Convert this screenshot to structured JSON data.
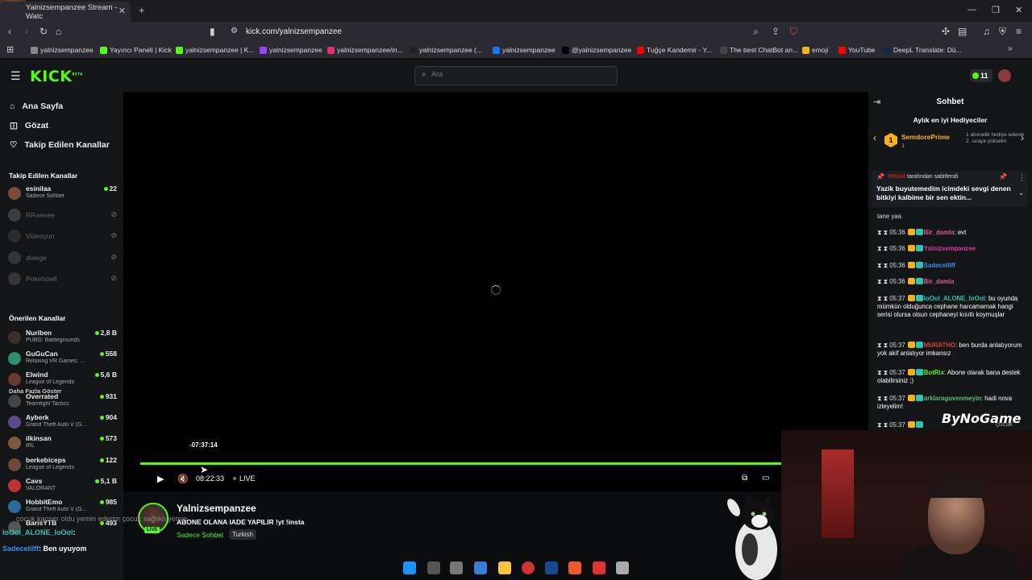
{
  "browser": {
    "tab_title": "Yalnizsempanzee Stream - Watc",
    "tab_close": "✕",
    "new_tab": "+",
    "url": "kick.com/yalnizsempanzee",
    "overlay_number": "12",
    "bookmarks": [
      {
        "label": "yalnizsempanzee",
        "color": "#888888"
      },
      {
        "label": "Yayıncı Paneli | Kick",
        "color": "#53fc18"
      },
      {
        "label": "yalnizsempanzee | K...",
        "color": "#53fc18"
      },
      {
        "label": "yalnizsempanzee",
        "color": "#9146ff"
      },
      {
        "label": "yalnizsempanzee/in...",
        "color": "#e1306c"
      },
      {
        "label": "yalnizsempanzee (...",
        "color": "#222222"
      },
      {
        "label": "yalnizsempanzee",
        "color": "#1877f2"
      },
      {
        "label": "@yalnizsempanzee",
        "color": "#000000"
      },
      {
        "label": "Tuğçe Kandemir - Y...",
        "color": "#ff0000"
      },
      {
        "label": "The best ChatBot an...",
        "color": "#444444"
      },
      {
        "label": "emoji",
        "color": "#f5b31b"
      },
      {
        "label": "YouTube",
        "color": "#ff0000"
      },
      {
        "label": "DeepL Translate: Dü...",
        "color": "#0f2b46"
      }
    ]
  },
  "header": {
    "logo": "KICK",
    "logo_sup": "BETA",
    "search_placeholder": "Ara",
    "coins": "11"
  },
  "sidebar": {
    "nav": [
      {
        "label": "Ana Sayfa",
        "icon": "home-icon"
      },
      {
        "label": "Gözat",
        "icon": "browse-icon"
      },
      {
        "label": "Takip Edilen Kanallar",
        "icon": "heart-icon"
      }
    ],
    "followed_title": "Takip Edilen Kanallar",
    "followed": [
      {
        "name": "esinilaa",
        "sub": "Sadece Sohbet",
        "viewers": "22",
        "live": true
      },
      {
        "name": "RRaenee",
        "sub": "",
        "viewers": "",
        "live": false
      },
      {
        "name": "Videoyun",
        "sub": "",
        "viewers": "",
        "live": false
      },
      {
        "name": "diaege",
        "sub": "",
        "viewers": "",
        "live": false
      },
      {
        "name": "Pokehowll",
        "sub": "",
        "viewers": "",
        "live": false
      }
    ],
    "show_more": "Daha Fazla Göster",
    "recommended_title": "Önerilen Kanallar",
    "recommended": [
      {
        "name": "Nuriben",
        "sub": "PUBG: Battlegrounds",
        "viewers": "2,8 B"
      },
      {
        "name": "GuGuCan",
        "sub": "Relaxing VR Games: ...",
        "viewers": "558"
      },
      {
        "name": "Elwind",
        "sub": "League of Legends",
        "viewers": "5,6 B"
      },
      {
        "name": "Overrated",
        "sub": "Teamfight Tactics",
        "viewers": "931"
      },
      {
        "name": "Ayberk",
        "sub": "Grand Theft Auto V (G...",
        "viewers": "904"
      },
      {
        "name": "ilkinsan",
        "sub": "IRL",
        "viewers": "573"
      },
      {
        "name": "berkebiceps",
        "sub": "League of Legends",
        "viewers": "122"
      },
      {
        "name": "Cavs",
        "sub": "VALORANT",
        "viewers": "5,1 B"
      },
      {
        "name": "HobbitEmo",
        "sub": "Grand Theft Auto V (G...",
        "viewers": "985"
      },
      {
        "name": "BarisYTB",
        "sub": "",
        "viewers": "493"
      }
    ]
  },
  "player": {
    "scrub_time": "-07:37:14",
    "timecode": "08:22:33",
    "live_label": "LIVE",
    "progress": 1.0
  },
  "stream": {
    "name": "Yalnizsempanzee",
    "live_badge": "LIVE",
    "title": "ABONE OLANA IADE YAPILIR !yt !insta",
    "category": "Sadece Sohbet",
    "language": "Turkish"
  },
  "chat": {
    "title": "Sohbet",
    "gifters_title": "Aylık en iyi Hediyeciler",
    "gifter": {
      "rank": "1",
      "name": "SemdorePrime",
      "count": "1",
      "note": "1 abonelik hediye ederek 2. sıraya yükselin"
    },
    "pinned_by_user": "Ritto34",
    "pinned_by": "tarafından sabitlendi",
    "pinned_text": "Yazik buyutemedim icimdeki sevgi denen bitkiyi kalbime bir sen ektin...",
    "partial_text": "tane yaa",
    "messages": [
      {
        "time": "05:36",
        "user": "Bir_damla",
        "color": "#e05a8a",
        "text": "evt"
      },
      {
        "time": "05:36",
        "user": "Yalnizsempanzee",
        "color": "#d13aa6",
        "text": ""
      },
      {
        "time": "05:36",
        "user": "Sadecelilff",
        "color": "#3a8cf0",
        "text": ""
      },
      {
        "time": "05:36",
        "user": "Bir_damla",
        "color": "#e05a8a",
        "text": ""
      },
      {
        "time": "05:37",
        "user": "loOol_ALONE_loOol",
        "color": "#2ec4b6",
        "text": "bu oyunda mümkün olduğunca cephane harcamamak hangi serisi olursa olsun cephaneyi kısıtlı koymuşlar"
      },
      {
        "time": "05:37",
        "user": "MURATHO",
        "color": "#e23b3b",
        "text": "ben burda anlatıyorum yok akif anlatıyor imkansız"
      },
      {
        "time": "05:37",
        "user": "BotRix",
        "color": "#53fc18",
        "text": "Abone olarak bana destek olabilirsiniz ;)"
      },
      {
        "time": "05:37",
        "user": "arklaraguvenmeyin",
        "color": "#53c27a",
        "text": "hadi nova izleyelim!"
      },
      {
        "time": "05:37",
        "user": "",
        "color": "#888888",
        "text": ""
      }
    ]
  },
  "overlay": {
    "cam_logo": "ByNoGame",
    "cam_logo_tail": "çocuk",
    "overlay_chat": [
      {
        "user": "",
        "text": "çocuk kanser oldu yemin ederim çocuk sağlıklı yemin",
        "color": "#888888"
      },
      {
        "user": "loOol_ALONE_loOol",
        "text": ":",
        "color": "#2ec4b6"
      },
      {
        "user": "Sadecelilff",
        "text": ": Ben uyuyom",
        "color": "#3a8cf0"
      }
    ]
  }
}
